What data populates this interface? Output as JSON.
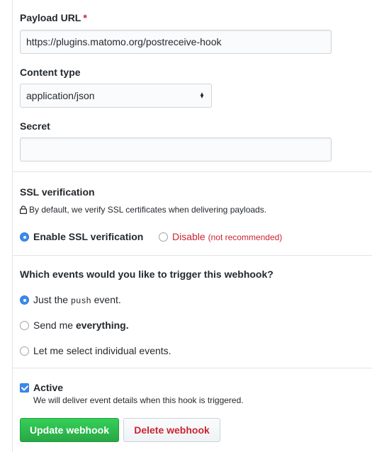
{
  "payload": {
    "label": "Payload URL",
    "required_mark": "*",
    "value": "https://plugins.matomo.org/postreceive-hook"
  },
  "content_type": {
    "label": "Content type",
    "selected": "application/json"
  },
  "secret": {
    "label": "Secret",
    "value": ""
  },
  "ssl": {
    "heading": "SSL verification",
    "note": "By default, we verify SSL certificates when delivering payloads.",
    "enable_label": "Enable SSL verification",
    "disable_label": "Disable",
    "disable_note": "(not recommended)",
    "selected": "enable"
  },
  "events": {
    "heading": "Which events would you like to trigger this webhook?",
    "option_push_pre": "Just the",
    "option_push_code": "push",
    "option_push_post": "event.",
    "option_everything_pre": "Send me",
    "option_everything_bold": "everything.",
    "option_individual": "Let me select individual events.",
    "selected": "push"
  },
  "active": {
    "label": "Active",
    "description": "We will deliver event details when this hook is triggered.",
    "checked": true
  },
  "actions": {
    "update_label": "Update webhook",
    "delete_label": "Delete webhook"
  },
  "colors": {
    "primary": "#28a745",
    "danger": "#cb2431",
    "radio_checked": "#3b8beb"
  }
}
